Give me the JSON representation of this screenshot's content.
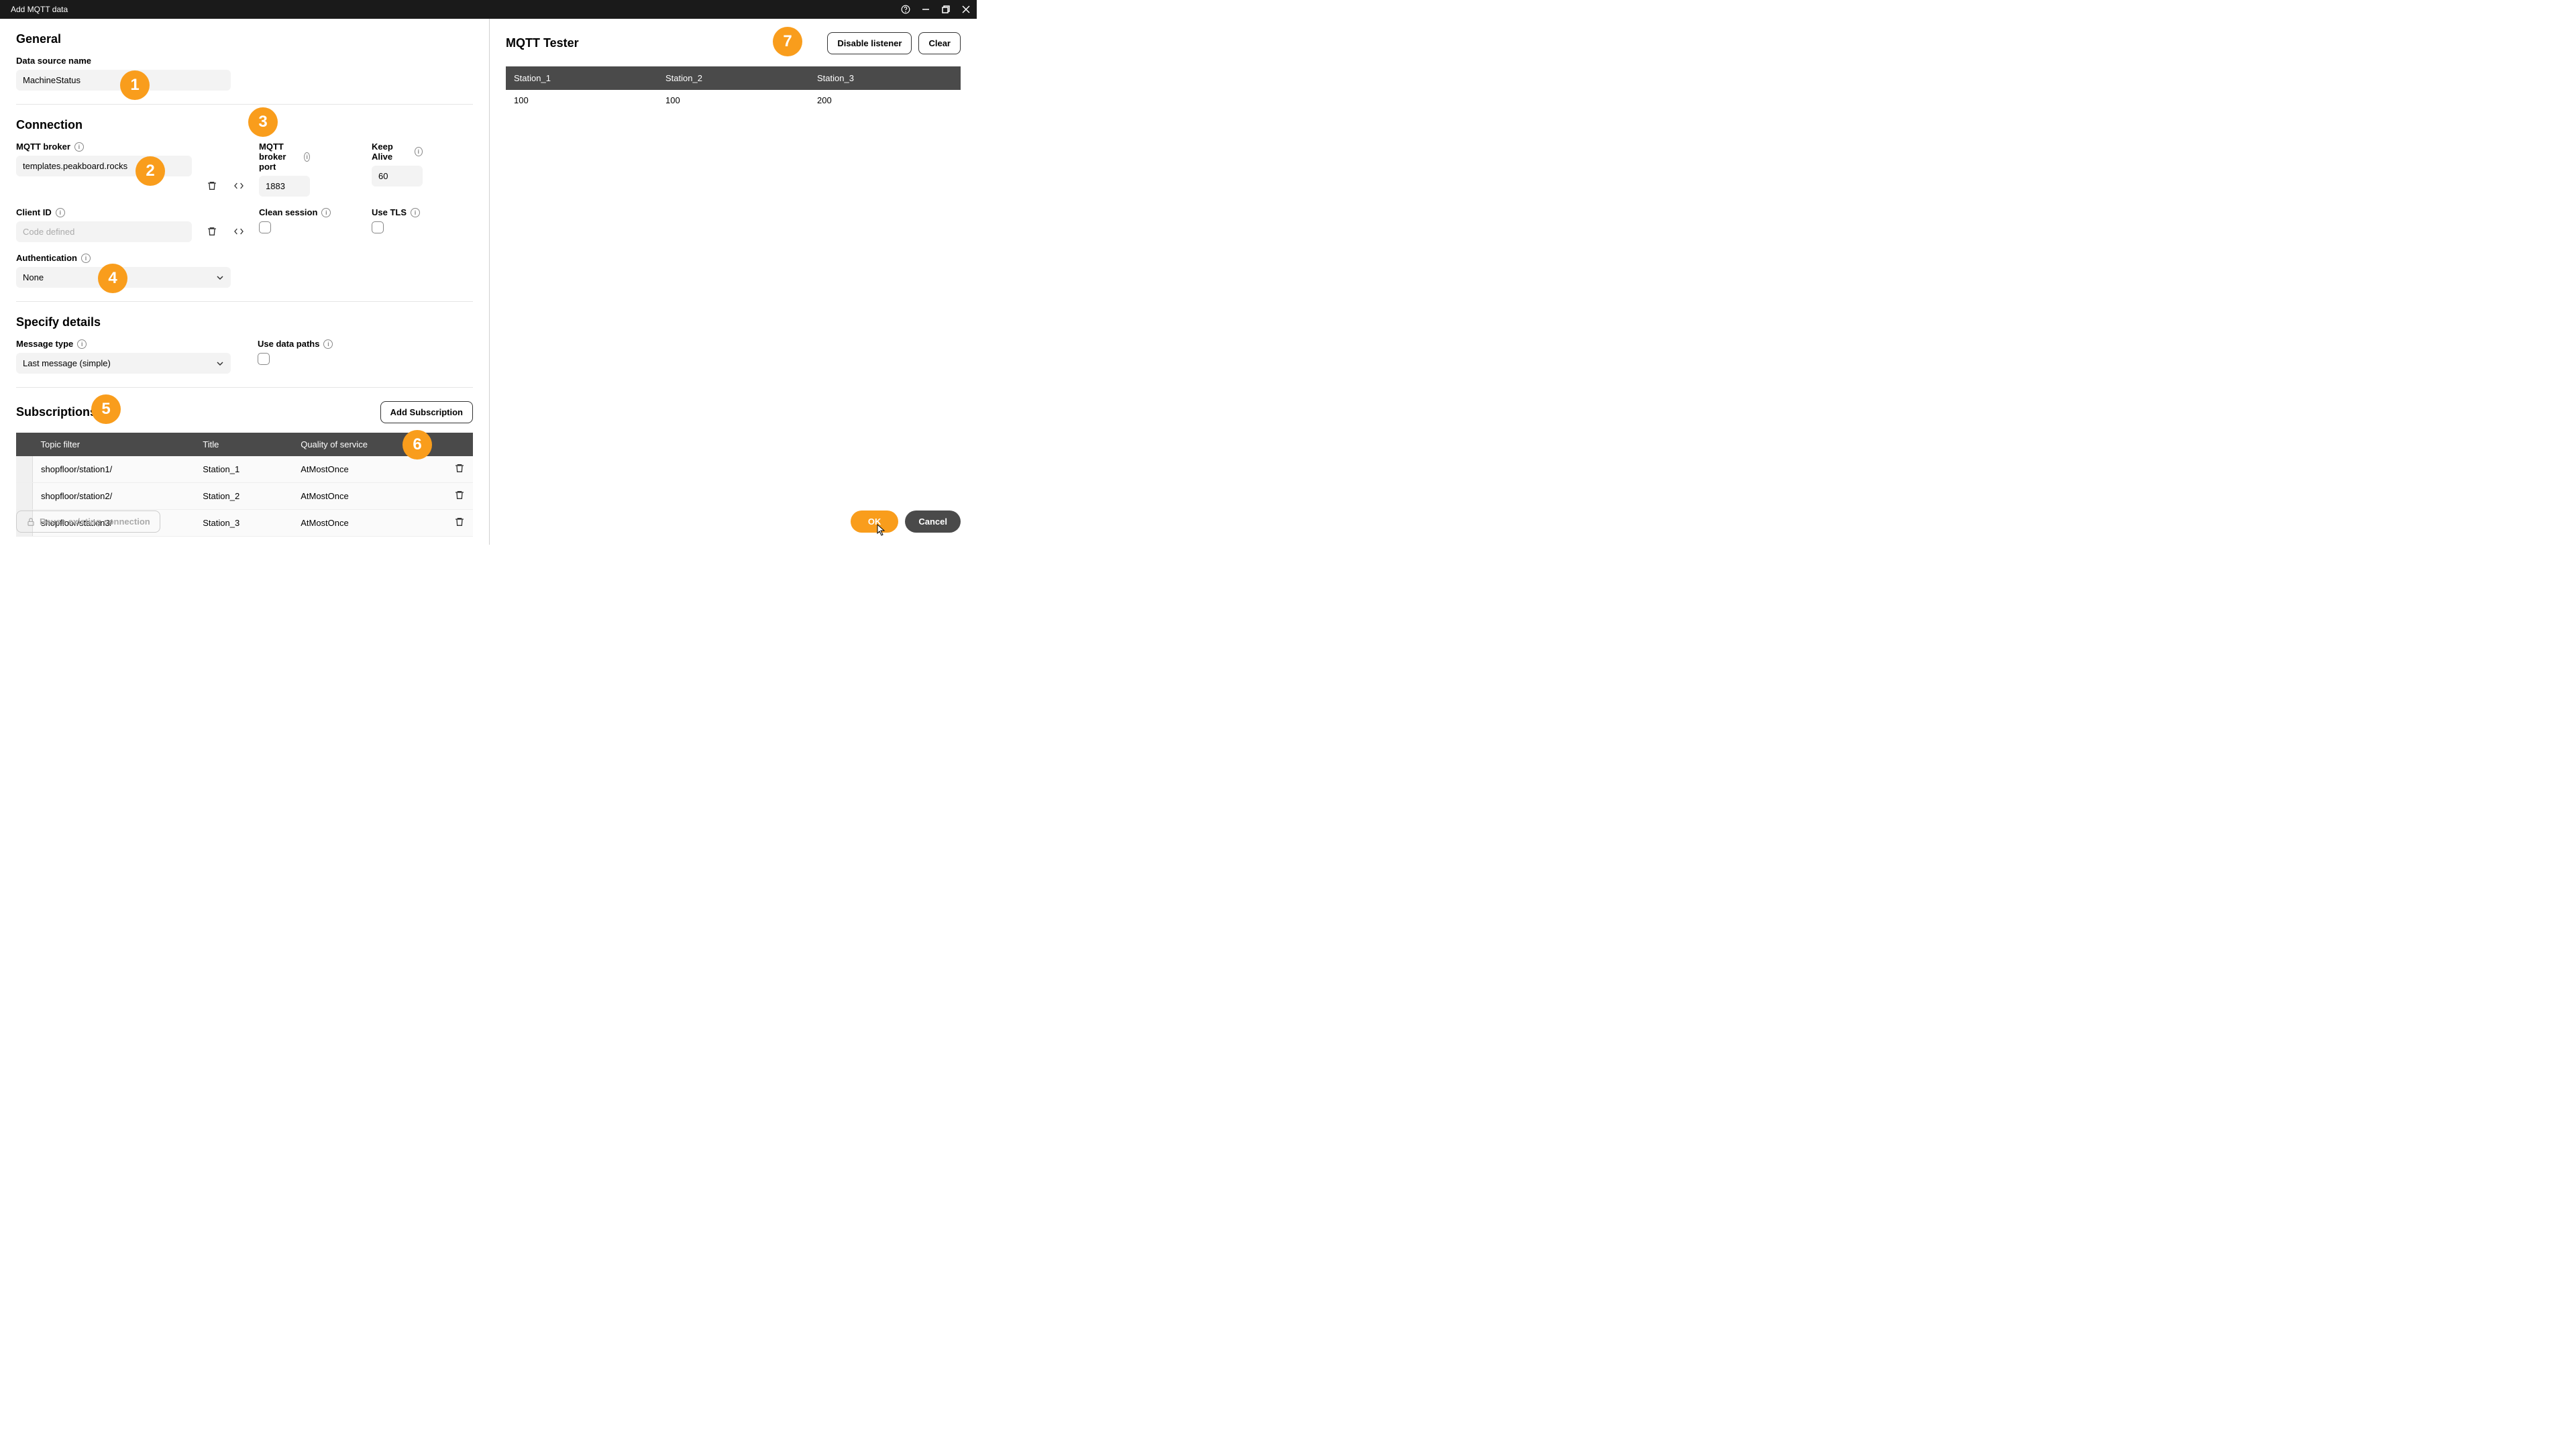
{
  "titlebar": {
    "title": "Add MQTT data"
  },
  "general": {
    "heading": "General",
    "data_source_name_label": "Data source name",
    "data_source_name": "MachineStatus"
  },
  "connection": {
    "heading": "Connection",
    "mqtt_broker_label": "MQTT broker",
    "mqtt_broker": "templates.peakboard.rocks",
    "mqtt_broker_port_label": "MQTT broker port",
    "mqtt_broker_port": "1883",
    "keep_alive_label": "Keep Alive",
    "keep_alive": "60",
    "client_id_label": "Client ID",
    "client_id_placeholder": "Code defined",
    "clean_session_label": "Clean session",
    "use_tls_label": "Use TLS",
    "authentication_label": "Authentication",
    "authentication": "None"
  },
  "details": {
    "heading": "Specify details",
    "message_type_label": "Message type",
    "message_type": "Last message (simple)",
    "use_data_paths_label": "Use data paths"
  },
  "subscriptions": {
    "heading": "Subscriptions",
    "add_label": "Add Subscription",
    "columns": {
      "topic": "Topic filter",
      "title": "Title",
      "qos": "Quality of service"
    },
    "rows": [
      {
        "topic": "shopfloor/station1/",
        "title": "Station_1",
        "qos": "AtMostOnce"
      },
      {
        "topic": "shopfloor/station2/",
        "title": "Station_2",
        "qos": "AtMostOnce"
      },
      {
        "topic": "shopfloor/station3/",
        "title": "Station_3",
        "qos": "AtMostOnce"
      }
    ]
  },
  "reuse_label": "Reuse existing connection",
  "tester": {
    "heading": "MQTT Tester",
    "disable_label": "Disable listener",
    "clear_label": "Clear",
    "columns": [
      "Station_1",
      "Station_2",
      "Station_3"
    ],
    "row": [
      "100",
      "100",
      "200"
    ]
  },
  "footer": {
    "ok": "OK",
    "cancel": "Cancel"
  },
  "badges": [
    "1",
    "2",
    "3",
    "4",
    "5",
    "6",
    "7"
  ]
}
